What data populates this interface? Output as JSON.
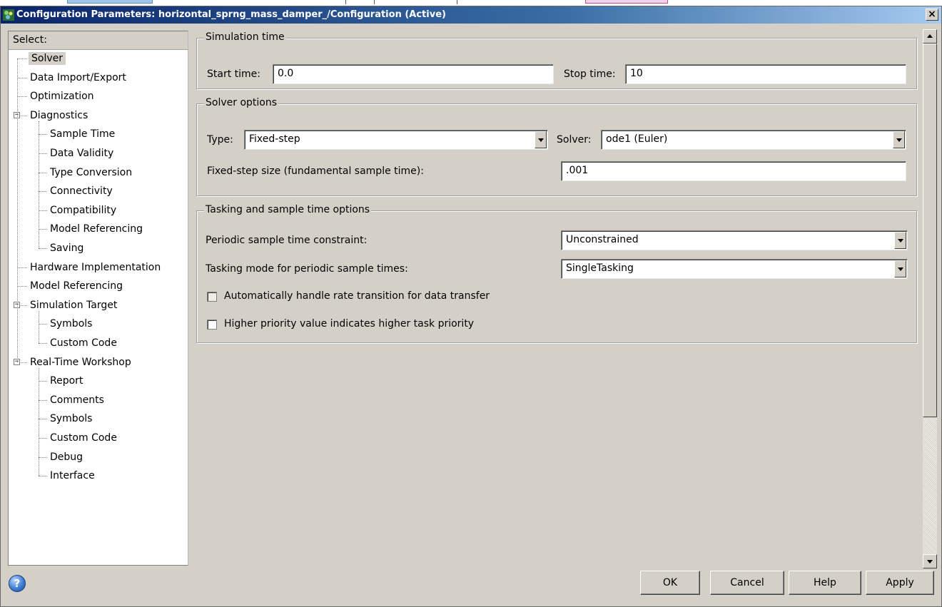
{
  "window": {
    "title": "Configuration Parameters: horizontal_sprng_mass_damper_/Configuration (Active)",
    "close_glyph": "×"
  },
  "tree": {
    "header": "Select:",
    "items": [
      {
        "label": "Solver",
        "level": 1,
        "selected": true
      },
      {
        "label": "Data Import/Export",
        "level": 1
      },
      {
        "label": "Optimization",
        "level": 1
      },
      {
        "label": "Diagnostics",
        "level": 1,
        "expanded": true
      },
      {
        "label": "Sample Time",
        "level": 2
      },
      {
        "label": "Data Validity",
        "level": 2
      },
      {
        "label": "Type Conversion",
        "level": 2
      },
      {
        "label": "Connectivity",
        "level": 2
      },
      {
        "label": "Compatibility",
        "level": 2
      },
      {
        "label": "Model Referencing",
        "level": 2
      },
      {
        "label": "Saving",
        "level": 2
      },
      {
        "label": "Hardware Implementation",
        "level": 1
      },
      {
        "label": "Model Referencing",
        "level": 1
      },
      {
        "label": "Simulation Target",
        "level": 1,
        "expanded": true
      },
      {
        "label": "Symbols",
        "level": 2
      },
      {
        "label": "Custom Code",
        "level": 2
      },
      {
        "label": "Real-Time Workshop",
        "level": 1,
        "expanded": true
      },
      {
        "label": "Report",
        "level": 2
      },
      {
        "label": "Comments",
        "level": 2
      },
      {
        "label": "Symbols",
        "level": 2
      },
      {
        "label": "Custom Code",
        "level": 2
      },
      {
        "label": "Debug",
        "level": 2
      },
      {
        "label": "Interface",
        "level": 2
      }
    ]
  },
  "simulation_time": {
    "title": "Simulation time",
    "start_label": "Start time:",
    "start_value": "0.0",
    "stop_label": "Stop time:",
    "stop_value": "10"
  },
  "solver_options": {
    "title": "Solver options",
    "type_label": "Type:",
    "type_value": "Fixed-step",
    "solver_label": "Solver:",
    "solver_value": "ode1 (Euler)",
    "step_label": "Fixed-step size (fundamental sample time):",
    "step_value": ".001"
  },
  "tasking": {
    "title": "Tasking and sample time options",
    "periodic_label": "Periodic sample time constraint:",
    "periodic_value": "Unconstrained",
    "mode_label": "Tasking mode for periodic sample times:",
    "mode_value": "SingleTasking",
    "auto_rate_label": "Automatically handle rate transition for data transfer",
    "auto_rate_checked": false,
    "priority_label": "Higher priority value indicates higher task priority",
    "priority_checked": false
  },
  "footer": {
    "help_glyph": "?",
    "ok": "OK",
    "cancel": "Cancel",
    "help": "Help",
    "apply": "Apply"
  }
}
